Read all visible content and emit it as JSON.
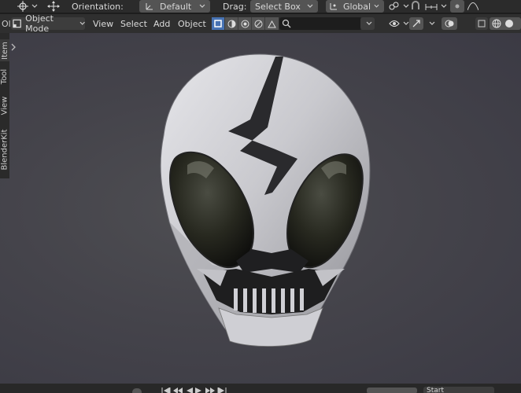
{
  "toolbar": {
    "orientation_label": "Orientation:",
    "orientation_value": "Default",
    "drag_label": "Drag:",
    "drag_value": "Select Box",
    "transform_value": "Global"
  },
  "header": {
    "mode": "Object Mode",
    "menus": [
      "View",
      "Select",
      "Add",
      "Object"
    ],
    "left_cut": "Ol"
  },
  "sidebar": {
    "tabs": [
      "Item",
      "Tool",
      "View",
      "BlenderKit"
    ]
  },
  "timeline": {
    "right_label": "Start"
  },
  "colors": {
    "accent": "#4772b3",
    "viewport_bg": "#45444b",
    "mask_metal": "#cfcfd3",
    "mask_black": "#1e1e1f"
  },
  "icons": [
    "cursor-icon",
    "move-icon",
    "orientation-icon",
    "transform-icon",
    "link-icon",
    "snap-icon",
    "proportional-icon",
    "eye-icon",
    "gizmo-icon",
    "overlay-icon",
    "shading-icon",
    "search-icon"
  ]
}
